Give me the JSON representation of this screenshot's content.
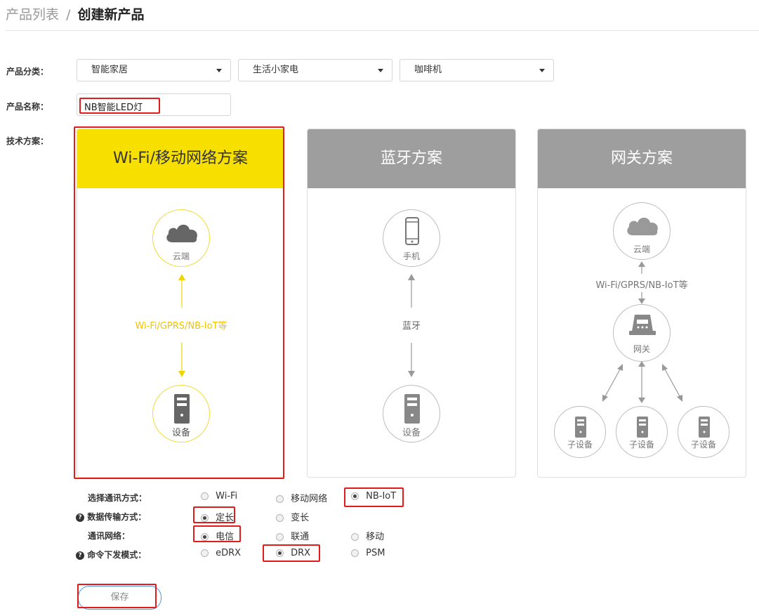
{
  "breadcrumb": {
    "parent": "产品列表",
    "separator": "/",
    "current": "创建新产品"
  },
  "form": {
    "category_label": "产品分类：",
    "categories": [
      {
        "value": "智能家居"
      },
      {
        "value": "生活小家电"
      },
      {
        "value": "咖啡机"
      }
    ],
    "name_label": "产品名称：",
    "name_value": "NB智能LED灯",
    "tech_label": "技术方案："
  },
  "schemes": [
    {
      "title": "Wi-Fi/移动网络方案",
      "selected": true,
      "top_node": "云端",
      "link": "Wi-Fi/GPRS/NB-IoT等",
      "bottom_node": "设备",
      "color": "#f7e000"
    },
    {
      "title": "蓝牙方案",
      "selected": false,
      "top_node": "手机",
      "link": "蓝牙",
      "bottom_node": "设备",
      "color": "#9e9e9e"
    },
    {
      "title": "网关方案",
      "selected": false,
      "top_node": "云端",
      "link": "Wi-Fi/GPRS/NB-IoT等",
      "middle_node": "网关",
      "sub_nodes": [
        "子设备",
        "子设备",
        "子设备"
      ],
      "color": "#9e9e9e"
    }
  ],
  "options": {
    "comm_mode": {
      "label": "选择通讯方式：",
      "choices": [
        "Wi-Fi",
        "移动网络",
        "NB-IoT"
      ],
      "selected": "NB-IoT"
    },
    "data_mode": {
      "label": "数据传输方式：",
      "choices": [
        "定长",
        "变长"
      ],
      "selected": "定长"
    },
    "network": {
      "label": "通讯网络：",
      "choices": [
        "电信",
        "联通",
        "移动"
      ],
      "selected": "电信"
    },
    "cmd_mode": {
      "label": "命令下发模式：",
      "choices": [
        "eDRX",
        "DRX",
        "PSM"
      ],
      "selected": "DRX"
    }
  },
  "save_label": "保存",
  "icons": [
    "cloud-icon",
    "phone-icon",
    "device-icon",
    "gateway-icon",
    "help-icon",
    "chevron-down-icon"
  ],
  "colors": {
    "accent_yellow": "#f7e000",
    "highlight_red": "#e21b1b",
    "gray_header": "#9e9e9e",
    "save_border": "#4b9be3"
  }
}
